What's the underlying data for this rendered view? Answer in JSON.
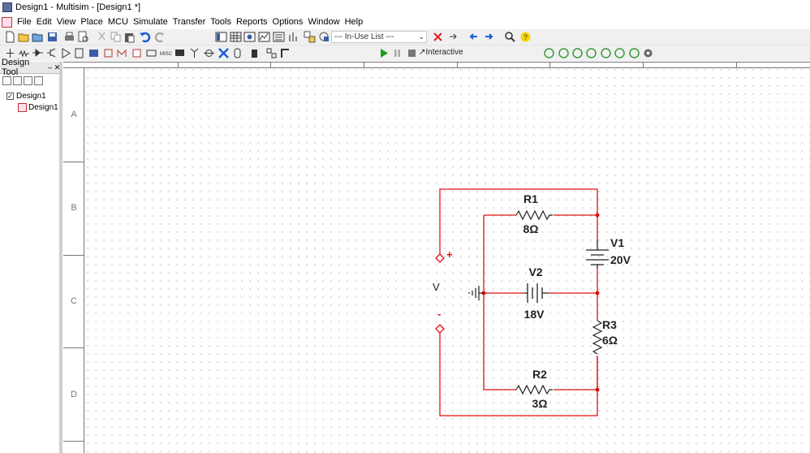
{
  "title": "Design1 - Multisim - [Design1 *]",
  "menu": [
    "File",
    "Edit",
    "View",
    "Place",
    "MCU",
    "Simulate",
    "Transfer",
    "Tools",
    "Reports",
    "Options",
    "Window",
    "Help"
  ],
  "toolbar": {
    "in_use_list": "--- In-Use List ---",
    "interactive_label": "Interactive"
  },
  "design_toolbox": {
    "title": "Design Tool",
    "tree": [
      {
        "label": "Design1",
        "kind": "design"
      },
      {
        "label": "Design1",
        "kind": "schematic"
      }
    ]
  },
  "sheet_rows": [
    "A",
    "B",
    "C",
    "D"
  ],
  "colors": {
    "wire": "#e01010",
    "component": "#222222",
    "canvas_dot": "#c4c4c4"
  },
  "circuit": {
    "components": [
      {
        "ref": "R1",
        "value": "8Ω",
        "type": "resistor"
      },
      {
        "ref": "R2",
        "value": "3Ω",
        "type": "resistor"
      },
      {
        "ref": "R3",
        "value": "6Ω",
        "type": "resistor"
      },
      {
        "ref": "V1",
        "value": "20V",
        "type": "dc-battery"
      },
      {
        "ref": "V2",
        "value": "18V",
        "type": "dc-battery"
      }
    ],
    "probe": {
      "label": "V",
      "plus": "+",
      "minus": "-"
    }
  }
}
